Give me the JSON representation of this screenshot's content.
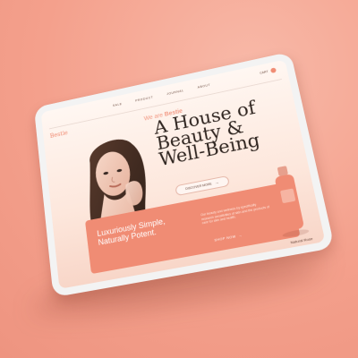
{
  "nav": {
    "items": [
      "SALE",
      "PRODUCT",
      "JOURNAL",
      "ABOUT"
    ],
    "cart_label": "CART"
  },
  "brand": {
    "name": "Bestie"
  },
  "hero": {
    "kicker_prefix": "We are",
    "kicker_brand": "Bestie",
    "title_lines": [
      "A House of",
      "Beauty &",
      "Well-Being"
    ],
    "cta_label": "DISCOVER MORE",
    "cta_icon": "arrow-right-icon"
  },
  "promo": {
    "headline_line1": "Luxuriously Simple,",
    "headline_line2": "Naturally Potent.",
    "body": "Our beauty and wellness by specifically research sensitivities of skin and the products of care for skin and health.",
    "shop_label": "SHOP NOW",
    "shop_icon": "arrow-right-icon"
  },
  "product": {
    "label": "Natural Rose"
  },
  "colors": {
    "background": "#f6a896",
    "accent": "#f08c74",
    "text_dark": "#2f2520",
    "tablet_frame": "#f3f3f3"
  }
}
